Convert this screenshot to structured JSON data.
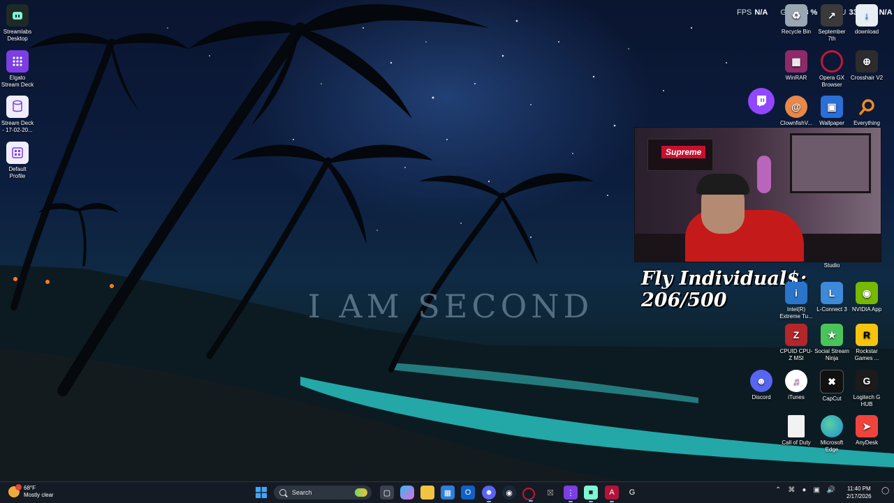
{
  "hardware_monitor": {
    "fps_label": "FPS",
    "fps_value": "N/A",
    "gpu_label": "GPU",
    "gpu_value": "28 %",
    "cpu_label": "CPU",
    "cpu_value": "33 %",
    "extra_value": "N/A"
  },
  "wallpaper_text": "I AM SECOND",
  "desktop_icons_left": [
    {
      "label": "Streamlabs Desktop",
      "icon": "streamlabs-icon"
    },
    {
      "label": "Elgato Stream Deck",
      "icon": "stream-deck-icon"
    },
    {
      "label": "Stream Deck - 17-02-20...",
      "icon": "file-icon"
    },
    {
      "label": "Default Profile",
      "icon": "profile-icon"
    }
  ],
  "desktop_icons_right": [
    {
      "label": "Recycle Bin",
      "icon": "recycle-bin-icon",
      "color": "#9aa6b2"
    },
    {
      "label": "September 7th",
      "icon": "shortcut-icon",
      "color": "#3a3a3a"
    },
    {
      "label": "download",
      "icon": "download-icon",
      "color": "#e8eef5"
    },
    {
      "label": "WinRAR",
      "icon": "winrar-icon",
      "color": "#8e2a6a"
    },
    {
      "label": "Opera GX Browser",
      "icon": "opera-gx-icon",
      "color": "#c4163a"
    },
    {
      "label": "Crosshair V2",
      "icon": "crosshair-icon",
      "color": "#2c2c2c"
    },
    {
      "label": "Twitch",
      "icon": "twitch-icon",
      "color": "#9146ff"
    },
    {
      "label": "ClownfishV...",
      "icon": "clownfish-icon",
      "color": "#e8884a"
    },
    {
      "label": "Wallpaper",
      "icon": "wallpaper-icon",
      "color": "#2a6fd6"
    },
    {
      "label": "Everything",
      "icon": "everything-icon",
      "color": "#f08a24"
    },
    {
      "label": "Intel(R) Extreme Tu...",
      "icon": "intel-icon",
      "color": "#2a75c9"
    },
    {
      "label": "L-Connect 3",
      "icon": "lconnect-icon",
      "color": "#3d8ad8"
    },
    {
      "label": "NVIDIA App",
      "icon": "nvidia-icon",
      "color": "#76b900"
    },
    {
      "label": "CPUID CPU-Z MSI",
      "icon": "cpuz-icon",
      "color": "#b3262a"
    },
    {
      "label": "Social Stream Ninja",
      "icon": "social-stream-icon",
      "color": "#4ac45a"
    },
    {
      "label": "Rockstar Games ...",
      "icon": "rockstar-icon",
      "color": "#f6c40f"
    },
    {
      "label": "Discord",
      "icon": "discord-icon",
      "color": "#5865f2"
    },
    {
      "label": "iTunes",
      "icon": "itunes-icon",
      "color": "#e26bd2"
    },
    {
      "label": "CapCut",
      "icon": "capcut-icon",
      "color": "#111111"
    },
    {
      "label": "Logitech G HUB",
      "icon": "ghub-icon",
      "color": "#1b1b1b"
    },
    {
      "label": "Call of Duty",
      "icon": "document-icon",
      "color": "#f2f2f2"
    },
    {
      "label": "Microsoft Edge",
      "icon": "edge-icon",
      "color": "#1f8fd6"
    },
    {
      "label": "AnyDesk",
      "icon": "anydesk-icon",
      "color": "#ef443b"
    }
  ],
  "studio_label": "Studio",
  "stream_overlay": {
    "counter_text": "Fly Individual$: 206/500",
    "cam_sign": "Supreme"
  },
  "taskbar": {
    "weather_temp": "68°F",
    "weather_desc": "Mostly clear",
    "search_placeholder": "Search",
    "time": "11:40 PM",
    "date": "2/17/2026",
    "apps": [
      "task-view-icon",
      "copilot-icon",
      "file-explorer-icon",
      "microsoft-store-icon",
      "outlook-icon",
      "discord-icon",
      "steam-icon",
      "opera-gx-icon",
      "xbox-icon",
      "stream-deck-icon",
      "streamlabs-icon",
      "adobe-icon",
      "ghub-icon"
    ]
  }
}
